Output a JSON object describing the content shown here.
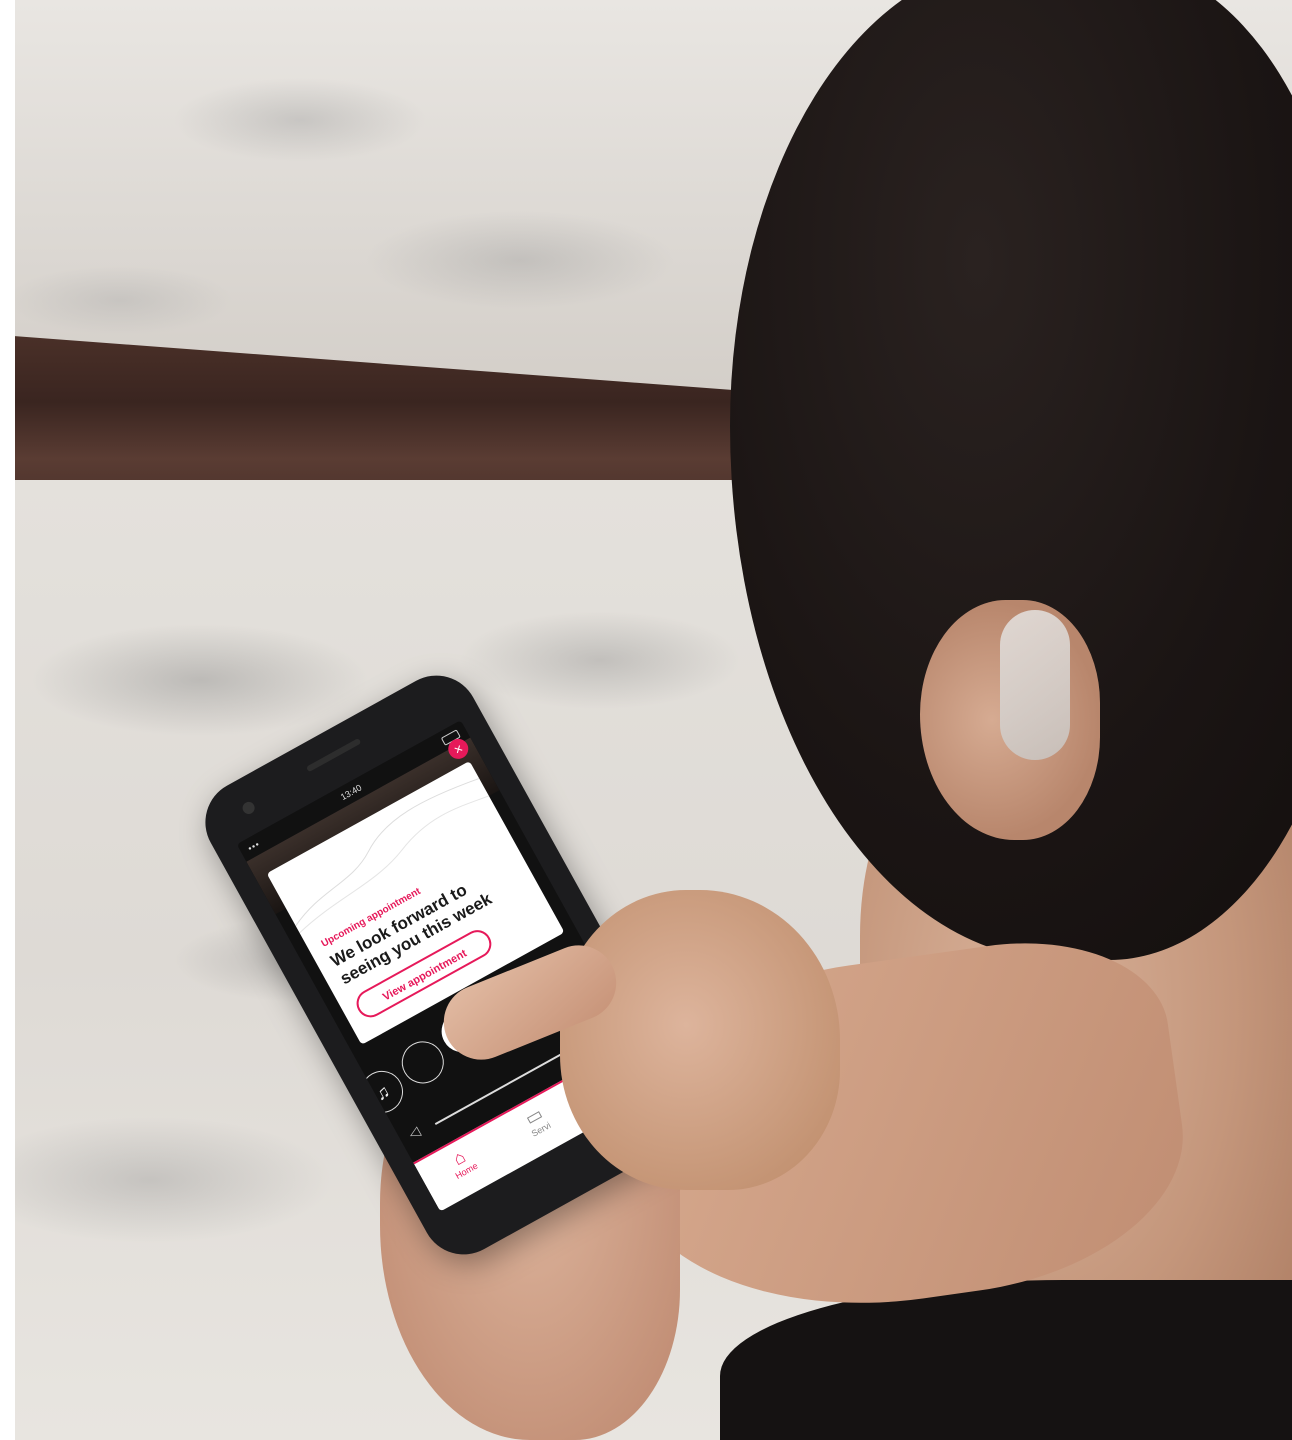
{
  "status_bar": {
    "time": "13:40"
  },
  "card": {
    "close_icon": "×",
    "eyebrow": "Upcoming appointment",
    "title": "We look forward to seeing you this week",
    "button_label": "View appointment"
  },
  "actions": [
    {
      "icon": "music-note-icon",
      "glyph": "♫"
    },
    {
      "icon": "circle-icon",
      "glyph": ""
    },
    {
      "icon": "calendar-icon",
      "glyph": "▭"
    },
    {
      "icon": "tv-icon",
      "glyph": "⎚"
    },
    {
      "icon": "phone-icon",
      "glyph": "✆"
    }
  ],
  "volume": {
    "icon": "speaker-icon",
    "glyph": "◁"
  },
  "tabbar": {
    "home_label": "Home",
    "services_label": "Servi"
  },
  "colors": {
    "accent": "#e6195a"
  }
}
